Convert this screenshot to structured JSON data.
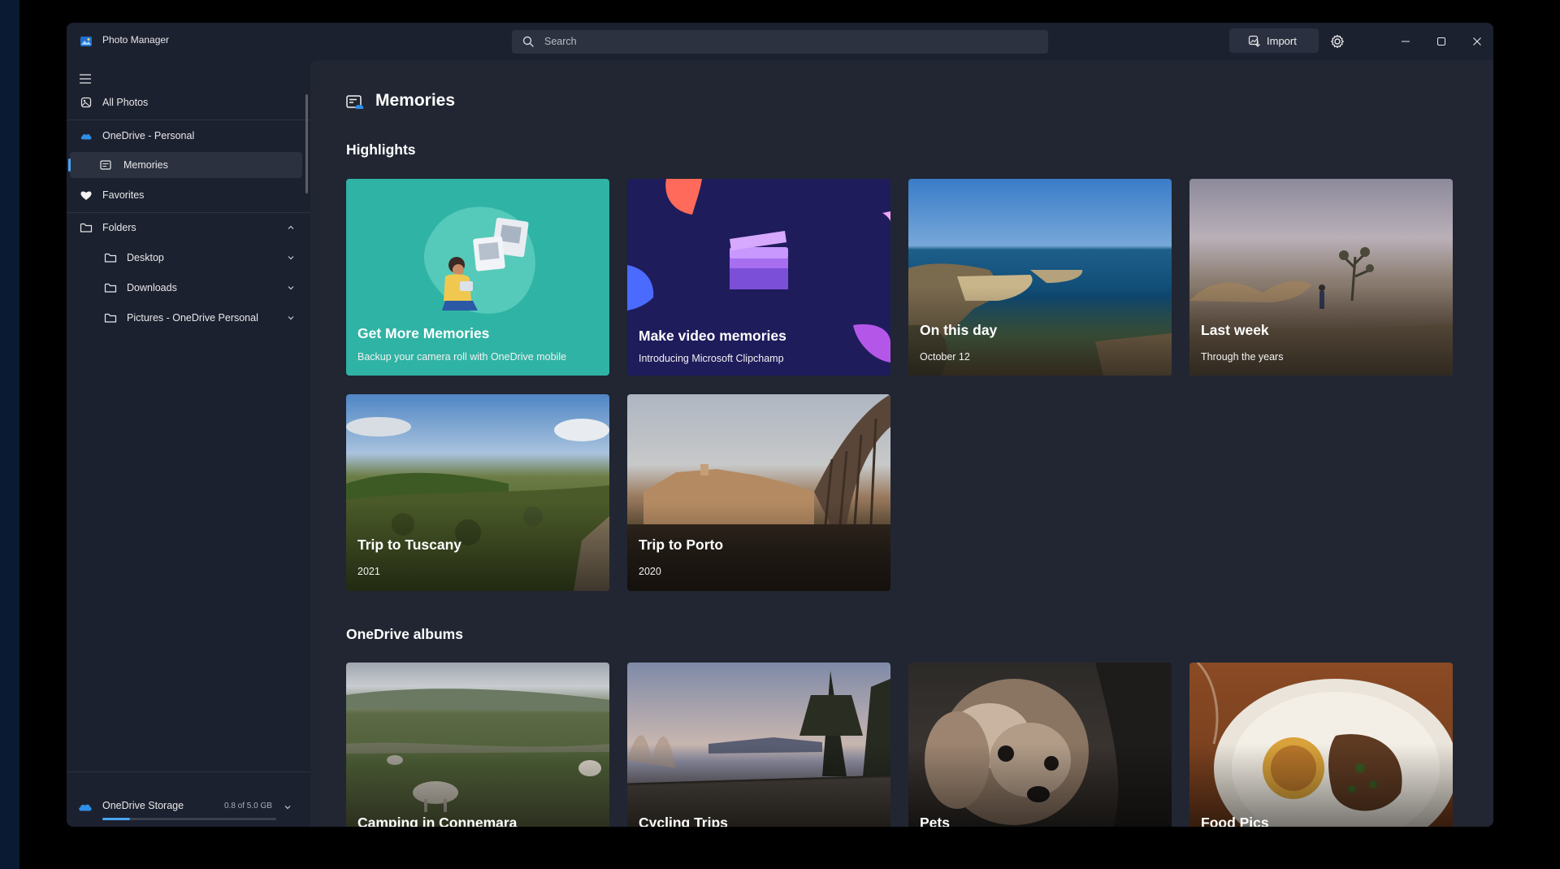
{
  "window": {
    "app_title": "Photo Manager",
    "search_placeholder": "Search",
    "import_label": "Import"
  },
  "sidebar": {
    "items": [
      {
        "label": "All Photos",
        "icon": "photos-icon"
      },
      {
        "label": "OneDrive - Personal",
        "icon": "onedrive-cloud-icon"
      },
      {
        "label": "Memories",
        "icon": "memories-icon",
        "selected": true
      },
      {
        "label": "Favorites",
        "icon": "heart-icon"
      },
      {
        "label": "Folders",
        "icon": "folder-icon",
        "expanded": true
      },
      {
        "label": "Desktop",
        "icon": "folder-icon"
      },
      {
        "label": "Downloads",
        "icon": "folder-icon"
      },
      {
        "label": "Pictures - OneDrive Personal",
        "icon": "folder-icon"
      }
    ],
    "storage": {
      "label": "OneDrive Storage",
      "amount": "0.8 of 5.0 GB",
      "used_gb": 0.8,
      "total_gb": 5.0
    }
  },
  "main": {
    "page_title": "Memories",
    "highlights_title": "Highlights",
    "albums_title": "OneDrive albums",
    "highlights": [
      {
        "title": "Get More Memories",
        "subtitle": "Backup your camera roll with OneDrive mobile"
      },
      {
        "title": "Make video memories",
        "subtitle": "Introducing Microsoft Clipchamp"
      },
      {
        "title": "On this day",
        "subtitle": "October 12"
      },
      {
        "title": "Last week",
        "subtitle": "Through the years"
      },
      {
        "title": "Trip to Tuscany",
        "subtitle": "2021"
      },
      {
        "title": "Trip to Porto",
        "subtitle": "2020"
      }
    ],
    "albums": [
      {
        "title": "Camping in Connemara"
      },
      {
        "title": "Cycling Trips"
      },
      {
        "title": "Pets"
      },
      {
        "title": "Food Pics"
      }
    ]
  },
  "colors": {
    "accent": "#4aa3f0",
    "window_bg": "#1c2130",
    "content_bg": "#212632",
    "teal_card": "#2fb3a4",
    "clipchamp_card": "#1e1d5a"
  }
}
